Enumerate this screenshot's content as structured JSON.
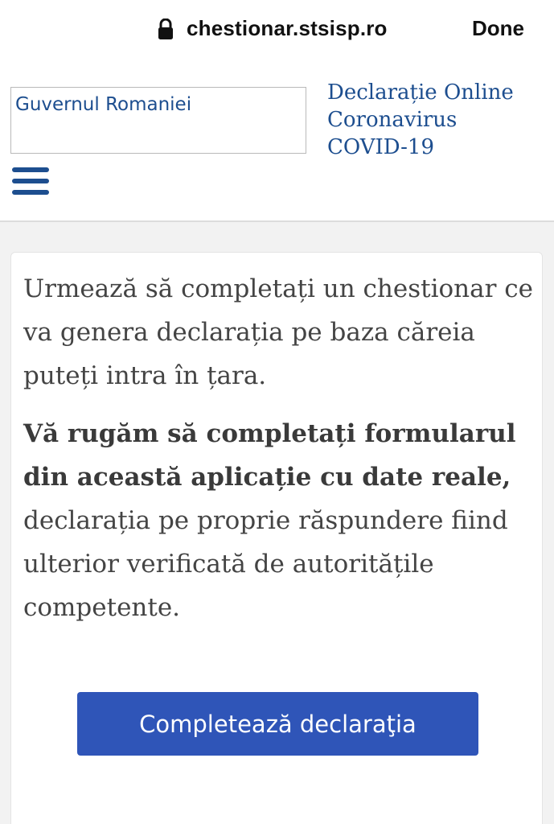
{
  "browser": {
    "url": "chestionar.stsisp.ro",
    "done_label": "Done",
    "lock_icon": "lock-icon"
  },
  "header": {
    "logo_text": "Guvernul Romaniei",
    "title_lines": [
      "Declarație Online",
      "Coronavirus",
      "COVID-19"
    ],
    "menu_icon": "hamburger-menu-icon"
  },
  "content": {
    "intro": "Urmează să completați un chestionar ce va genera declarația pe baza căreia puteți intra în țara.",
    "notice_bold": "Vă rugăm să completați formularul din această aplicație cu date reale,",
    "notice_regular": " declarația pe proprie răspundere fiind ulterior verificată de autoritățile competente.",
    "button_label": "Completează declaraţia"
  },
  "colors": {
    "brand_blue": "#1d4e8f",
    "button_blue": "#2f55b8",
    "page_background": "#f2f2f2",
    "body_text": "#444444"
  }
}
